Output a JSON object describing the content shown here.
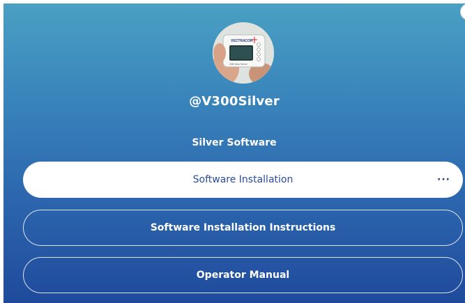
{
  "profile": {
    "handle": "@V300Silver",
    "avatar_brand": "VECTRACOR",
    "avatar_caption": "V300 Silver Monitor"
  },
  "section": {
    "title": "Silver Software"
  },
  "links": [
    {
      "label": "Software Installation",
      "more": "···"
    },
    {
      "label": "Software Installation Instructions"
    },
    {
      "label": "Operator Manual"
    }
  ],
  "colors": {
    "gradient_top": "#4aa0c3",
    "gradient_bottom": "#1f4a9c",
    "primary_button_text": "#2a4a9a"
  }
}
